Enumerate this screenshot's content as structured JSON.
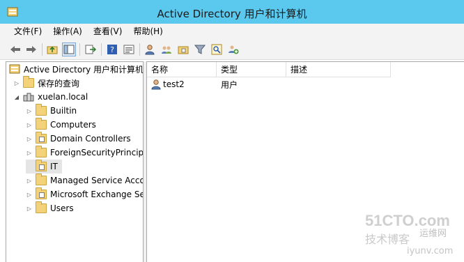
{
  "window": {
    "title": "Active Directory 用户和计算机"
  },
  "menu": [
    {
      "label": "文件(F)"
    },
    {
      "label": "操作(A)"
    },
    {
      "label": "查看(V)"
    },
    {
      "label": "帮助(H)"
    }
  ],
  "tree": {
    "root": "Active Directory 用户和计算机",
    "saved_queries": "保存的查询",
    "domain": "xuelan.local",
    "children": [
      {
        "label": "Builtin"
      },
      {
        "label": "Computers"
      },
      {
        "label": "Domain Controllers"
      },
      {
        "label": "ForeignSecurityPrincipa"
      },
      {
        "label": "IT"
      },
      {
        "label": "Managed Service Acco"
      },
      {
        "label": "Microsoft Exchange Se"
      },
      {
        "label": "Users"
      }
    ]
  },
  "list": {
    "columns": [
      "名称",
      "类型",
      "描述"
    ],
    "rows": [
      {
        "name": "test2",
        "type": "用户",
        "desc": ""
      }
    ]
  },
  "watermark": {
    "brand": "51CTO.com",
    "line2": "技术博客",
    "line3": "运维网",
    "url": "iyunv.com"
  },
  "colors": {
    "titlebar": "#5bc8ee",
    "chrome": "#f3f3f3",
    "folder": "#f3d27a"
  }
}
